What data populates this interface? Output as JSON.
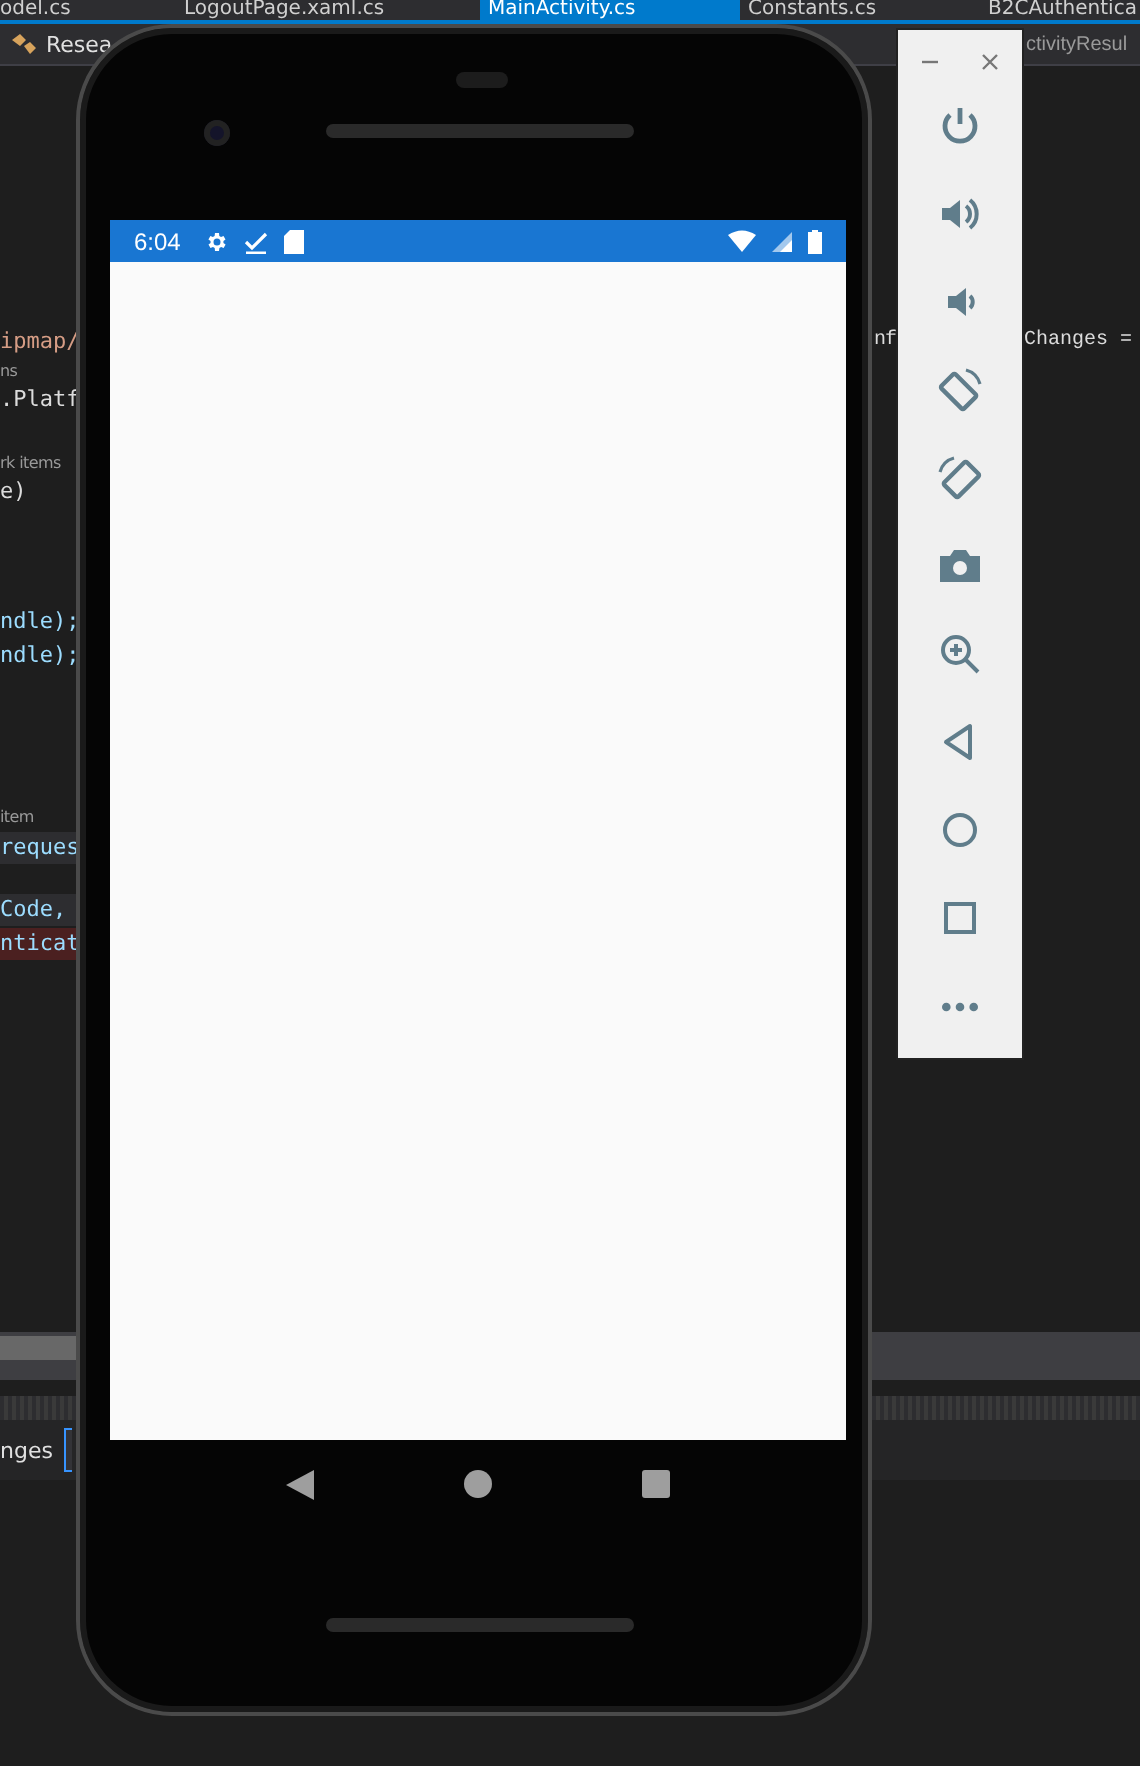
{
  "ide": {
    "tabs": [
      {
        "label": "odel.cs",
        "selected": false
      },
      {
        "label": "LogoutPage.xaml.cs",
        "selected": false
      },
      {
        "label": "MainActivity.cs",
        "selected": true
      },
      {
        "label": "Constants.cs",
        "selected": false
      },
      {
        "label": "B2CAuthentica",
        "selected": false
      }
    ],
    "nav_left": "Resea",
    "nav_right": "ctivityResul",
    "code_lines": [
      {
        "text": "ipmap/",
        "kind": "string",
        "highlighted": false,
        "error": false,
        "tail": [
          "nf",
          "Changes ="
        ]
      },
      {
        "text": "ns",
        "kind": "lens",
        "highlighted": false,
        "error": false
      },
      {
        "text": ".Platf",
        "kind": "plain",
        "highlighted": false,
        "error": false
      },
      {
        "text": "rk items",
        "kind": "lens",
        "highlighted": false,
        "error": false
      },
      {
        "text": "e)",
        "kind": "plain",
        "highlighted": false,
        "error": false
      },
      {
        "text": "ndle);",
        "kind": "identifier",
        "highlighted": false,
        "error": false
      },
      {
        "text": "ndle);",
        "kind": "identifier",
        "highlighted": false,
        "error": false
      },
      {
        "text": "item",
        "kind": "lens",
        "highlighted": false,
        "error": false
      },
      {
        "text": "reques",
        "kind": "identifier",
        "highlighted": true,
        "error": false
      },
      {
        "text": "Code,",
        "kind": "identifier",
        "highlighted": true,
        "error": false
      },
      {
        "text": "nticat",
        "kind": "identifier",
        "highlighted": false,
        "error": true
      }
    ],
    "bottom_label": "nges"
  },
  "phone": {
    "time": "6:04"
  }
}
